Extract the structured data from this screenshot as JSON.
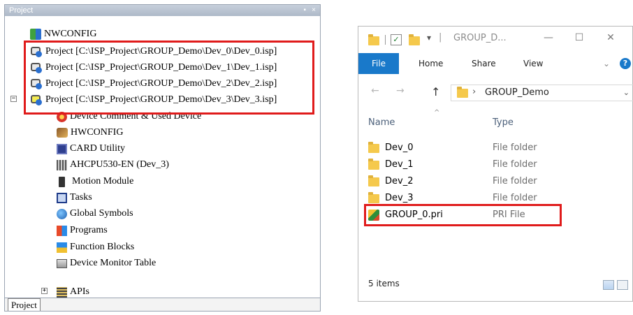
{
  "project_panel": {
    "title": "Project",
    "pin_icon": "pin-icon",
    "close_icon": "close-icon",
    "tab_label": "Project",
    "expander_expanded": "−",
    "expander_collapsed": "+",
    "items": [
      {
        "label": "NWCONFIG",
        "icon": "nwconfig-icon"
      },
      {
        "label": "Project [C:\\ISP_Project\\GROUP_Demo\\Dev_0\\Dev_0.isp]",
        "icon": "project-icon"
      },
      {
        "label": "Project [C:\\ISP_Project\\GROUP_Demo\\Dev_1\\Dev_1.isp]",
        "icon": "project-icon"
      },
      {
        "label": "Project [C:\\ISP_Project\\GROUP_Demo\\Dev_2\\Dev_2.isp]",
        "icon": "project-icon"
      },
      {
        "label": "Project [C:\\ISP_Project\\GROUP_Demo\\Dev_3\\Dev_3.isp]",
        "icon": "project-active-icon"
      },
      {
        "label": "Device Comment & Used Device",
        "icon": "device-comment-icon"
      },
      {
        "label": "HWCONFIG",
        "icon": "hwconfig-icon"
      },
      {
        "label": "CARD Utility",
        "icon": "card-utility-icon"
      },
      {
        "label": "AHCPU530-EN  (Dev_3)",
        "icon": "cpu-icon"
      },
      {
        "label": "Motion Module",
        "icon": "motion-module-icon"
      },
      {
        "label": "Tasks",
        "icon": "tasks-icon"
      },
      {
        "label": "Global Symbols",
        "icon": "global-symbols-icon"
      },
      {
        "label": "Programs",
        "icon": "programs-icon"
      },
      {
        "label": "Function Blocks",
        "icon": "function-blocks-icon"
      },
      {
        "label": "Device Monitor Table",
        "icon": "device-monitor-icon"
      },
      {
        "label": "APIs",
        "icon": "apis-icon"
      }
    ]
  },
  "explorer": {
    "window_title": "GROUP_D...",
    "quick_access_sep": "|",
    "minimize": "—",
    "maximize": "☐",
    "close": "✕",
    "ribbon": {
      "file": "File",
      "home": "Home",
      "share": "Share",
      "view": "View",
      "collapse": "⌄",
      "help": "?"
    },
    "nav": {
      "back": "←",
      "forward": "→",
      "up": "↑"
    },
    "address": {
      "chevron": "›",
      "path": "GROUP_Demo",
      "dropdown": "⌄"
    },
    "columns": {
      "name": "Name",
      "type": "Type",
      "sort_caret": "^"
    },
    "files": [
      {
        "name": "Dev_0",
        "type": "File folder",
        "icon": "folder-icon"
      },
      {
        "name": "Dev_1",
        "type": "File folder",
        "icon": "folder-icon"
      },
      {
        "name": "Dev_2",
        "type": "File folder",
        "icon": "folder-icon"
      },
      {
        "name": "Dev_3",
        "type": "File folder",
        "icon": "folder-icon"
      },
      {
        "name": "GROUP_0.pri",
        "type": "PRI File",
        "icon": "pri-file-icon"
      }
    ],
    "status": "5 items"
  },
  "colors": {
    "highlight_border": "#e01b1b",
    "file_tab": "#1979ca",
    "folder": "#f5c94c"
  }
}
